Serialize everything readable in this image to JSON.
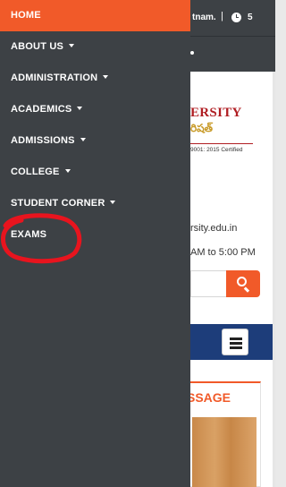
{
  "background": {
    "topbar_text": "tnam.",
    "topbar_separator": "|",
    "topbar_number": "5",
    "logo_title": "ERSITY",
    "logo_telugu": "రిషత్",
    "logo_cert": "9001: 2015 Certified",
    "contact_website": "rsity.edu.in",
    "contact_hours": "AM to 5:00 PM",
    "message_title": "SSAGE"
  },
  "drawer": {
    "items": [
      {
        "label": "HOME",
        "dropdown": false,
        "active": true
      },
      {
        "label": "ABOUT US",
        "dropdown": true,
        "active": false
      },
      {
        "label": "ADMINISTRATION",
        "dropdown": true,
        "active": false
      },
      {
        "label": "ACADEMICS",
        "dropdown": true,
        "active": false
      },
      {
        "label": "ADMISSIONS",
        "dropdown": true,
        "active": false
      },
      {
        "label": "COLLEGE",
        "dropdown": true,
        "active": false
      },
      {
        "label": "STUDENT CORNER",
        "dropdown": true,
        "active": false
      },
      {
        "label": "EXAMS",
        "dropdown": false,
        "active": false
      }
    ]
  },
  "colors": {
    "accent": "#f15a29",
    "drawer_bg": "#3d4145",
    "nav_blue": "#1d3d7a",
    "logo_red": "#b01e23",
    "annotation_red": "#e8141e"
  },
  "icons": {
    "clock": "clock-icon",
    "search": "search-icon",
    "menu": "hamburger-menu-icon",
    "dropdown": "caret-down-icon"
  }
}
